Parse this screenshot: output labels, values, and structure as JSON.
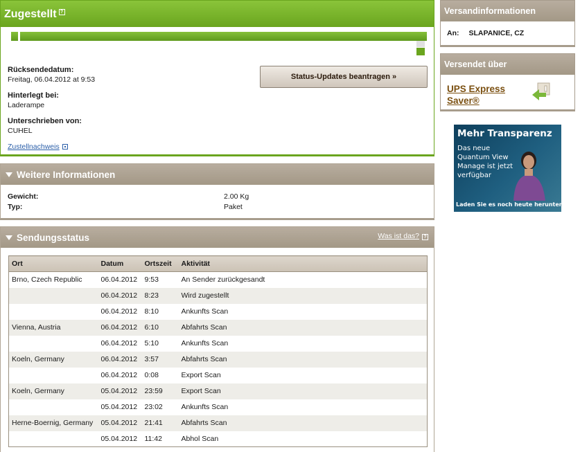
{
  "delivered": {
    "title": "Zugestellt",
    "progress_fraction": 1.0,
    "return_label": "Rücksendedatum:",
    "return_value": "Freitag,  06.04.2012 at 9:53",
    "deposited_label": "Hinterlegt bei:",
    "deposited_value": "Laderampe",
    "signed_label": "Unterschrieben von:",
    "signed_value": "CUHEL",
    "proof_link": "Zustellnachweis",
    "status_button": "Status-Updates beantragen »"
  },
  "more_info": {
    "title": "Weitere Informationen",
    "weight_label": "Gewicht:",
    "weight_value": "2.00 Kg",
    "type_label": "Typ:",
    "type_value": "Paket"
  },
  "shipment_status": {
    "title": "Sendungsstatus",
    "what_is_link": "Was ist das?",
    "columns": [
      "Ort",
      "Datum",
      "Ortszeit",
      "Aktivität"
    ],
    "rows": [
      [
        "Brno, Czech Republic",
        "06.04.2012",
        "9:53",
        "An Sender zurückgesandt"
      ],
      [
        "",
        "06.04.2012",
        "8:23",
        "Wird zugestellt"
      ],
      [
        "",
        "06.04.2012",
        "8:10",
        "Ankunfts Scan"
      ],
      [
        "Vienna, Austria",
        "06.04.2012",
        "6:10",
        "Abfahrts Scan"
      ],
      [
        "",
        "06.04.2012",
        "5:10",
        "Ankunfts Scan"
      ],
      [
        "Koeln, Germany",
        "06.04.2012",
        "3:57",
        "Abfahrts Scan"
      ],
      [
        "",
        "06.04.2012",
        "0:08",
        "Export Scan"
      ],
      [
        "Koeln, Germany",
        "05.04.2012",
        "23:59",
        "Export Scan"
      ],
      [
        "",
        "05.04.2012",
        "23:02",
        "Ankunfts Scan"
      ],
      [
        "Herne-Boernig, Germany",
        "05.04.2012",
        "21:41",
        "Abfahrts Scan"
      ],
      [
        "",
        "05.04.2012",
        "11:42",
        "Abhol Scan"
      ]
    ]
  },
  "shipping_info": {
    "title": "Versandinformationen",
    "to_label": "An:",
    "to_value": "SLAPANICE, CZ"
  },
  "sent_via": {
    "title": "Versendet über",
    "service": "UPS Express Saver®"
  },
  "ad": {
    "headline": "Mehr Transparenz",
    "body": "Das neue Quantum View Manage ist jetzt verfügbar",
    "cta": "Laden Sie es noch heute herunter »"
  },
  "colors": {
    "accent_green": "#6aa51e",
    "panel_header": "#a39886",
    "link_blue": "#2a5ea8",
    "service_brown": "#7a4f10"
  }
}
